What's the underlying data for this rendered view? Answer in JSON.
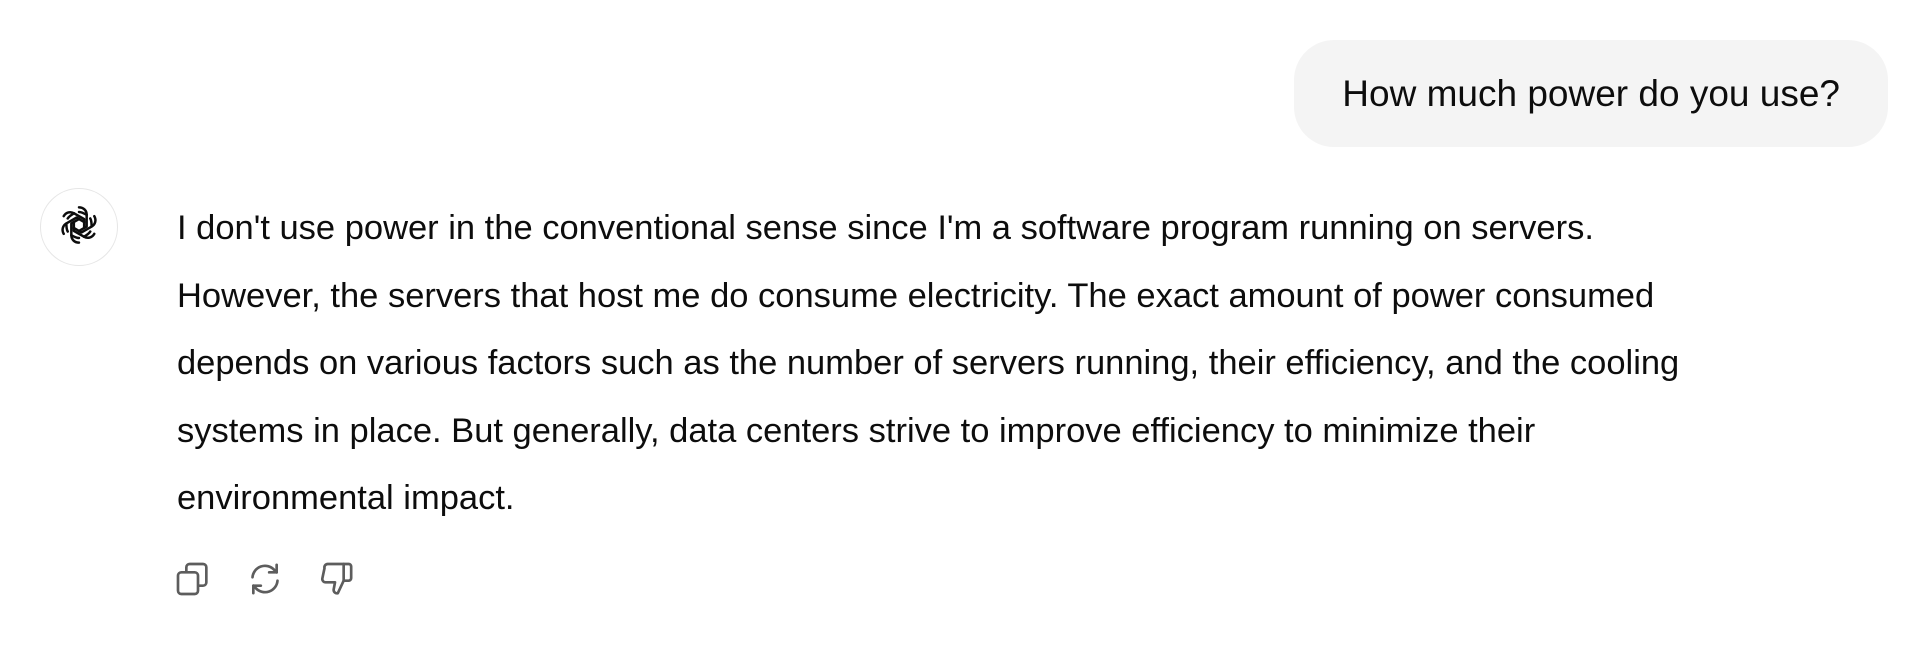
{
  "user_message": {
    "text": "How much power do you use?"
  },
  "assistant_message": {
    "avatar_icon": "openai-logo-icon",
    "lines": [
      "I don't use power in the conventional sense since I'm a software program running on servers.",
      "However, the servers that host me do consume electricity. The exact amount of power consumed",
      "depends on various factors such as the number of servers running, their efficiency, and the cooling",
      "systems in place. But generally, data centers strive to improve efficiency to minimize their",
      "environmental impact."
    ]
  },
  "message_actions": [
    {
      "icon": "copy-icon"
    },
    {
      "icon": "regenerate-icon"
    },
    {
      "icon": "thumbs-down-icon"
    }
  ],
  "colors": {
    "user_bubble_bg": "#f4f4f4",
    "text": "#0d0d0d",
    "icon": "#5d5d5d"
  }
}
